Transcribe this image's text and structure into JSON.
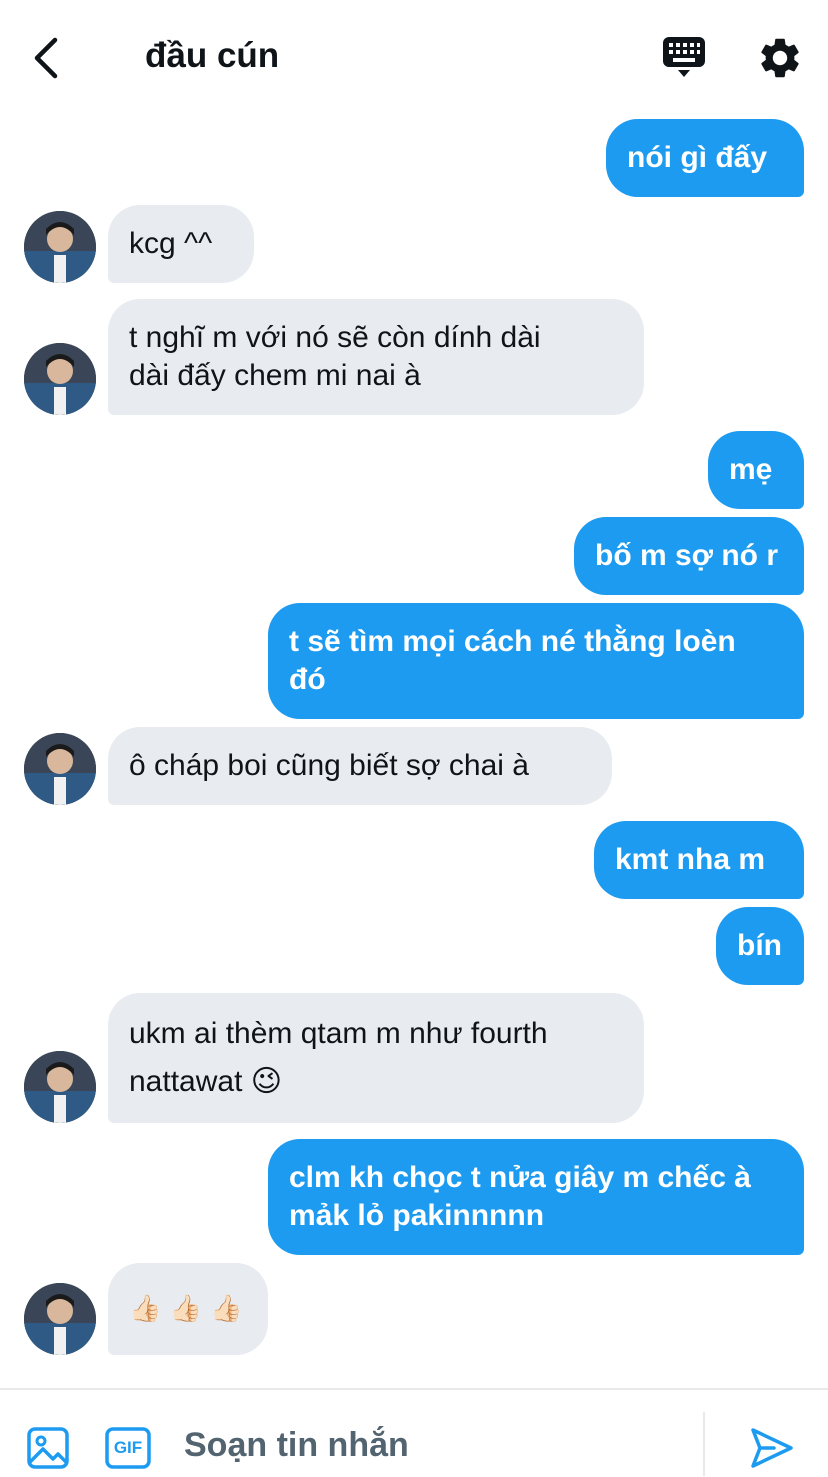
{
  "header": {
    "title": "đầu cún",
    "back_icon": "chevron-left-icon",
    "keyboard_icon": "keyboard-icon",
    "settings_icon": "gear-icon"
  },
  "messages": [
    {
      "direction": "sent",
      "text": "nói gì đấy"
    },
    {
      "direction": "received",
      "text": "kcg ^^"
    },
    {
      "direction": "received",
      "line1": "t nghĩ m với nó sẽ còn dính dài",
      "line2": "dài đấy chem mi nai à"
    },
    {
      "direction": "sent",
      "text": "mẹ"
    },
    {
      "direction": "sent",
      "text": "bố m sợ nó r"
    },
    {
      "direction": "sent",
      "line1": "t sẽ tìm mọi cách né thằng loèn",
      "line2": "đó"
    },
    {
      "direction": "received",
      "text": "ô cháp boi cũng biết sợ chai à"
    },
    {
      "direction": "sent",
      "text": "kmt nha m"
    },
    {
      "direction": "sent",
      "text": "bín"
    },
    {
      "direction": "received",
      "line1": "ukm ai thèm qtam m như fourth",
      "line2": "nattawat",
      "emoji": "😉"
    },
    {
      "direction": "sent",
      "line1": "clm kh chọc t nửa giây m chếc à",
      "line2": "mảk lỏ pakinnnnn"
    },
    {
      "direction": "received",
      "text": "👍🏻 👍🏻 👍🏻"
    }
  ],
  "composer": {
    "placeholder": "Soạn tin nhắn",
    "value": "",
    "gif_label": "GIF",
    "image_icon": "image-icon",
    "send_icon": "send-icon"
  },
  "colors": {
    "accent": "#1d9bf0",
    "received_bubble": "#e8ecf0",
    "text": "#0f1419",
    "secondary_text": "#536471"
  }
}
